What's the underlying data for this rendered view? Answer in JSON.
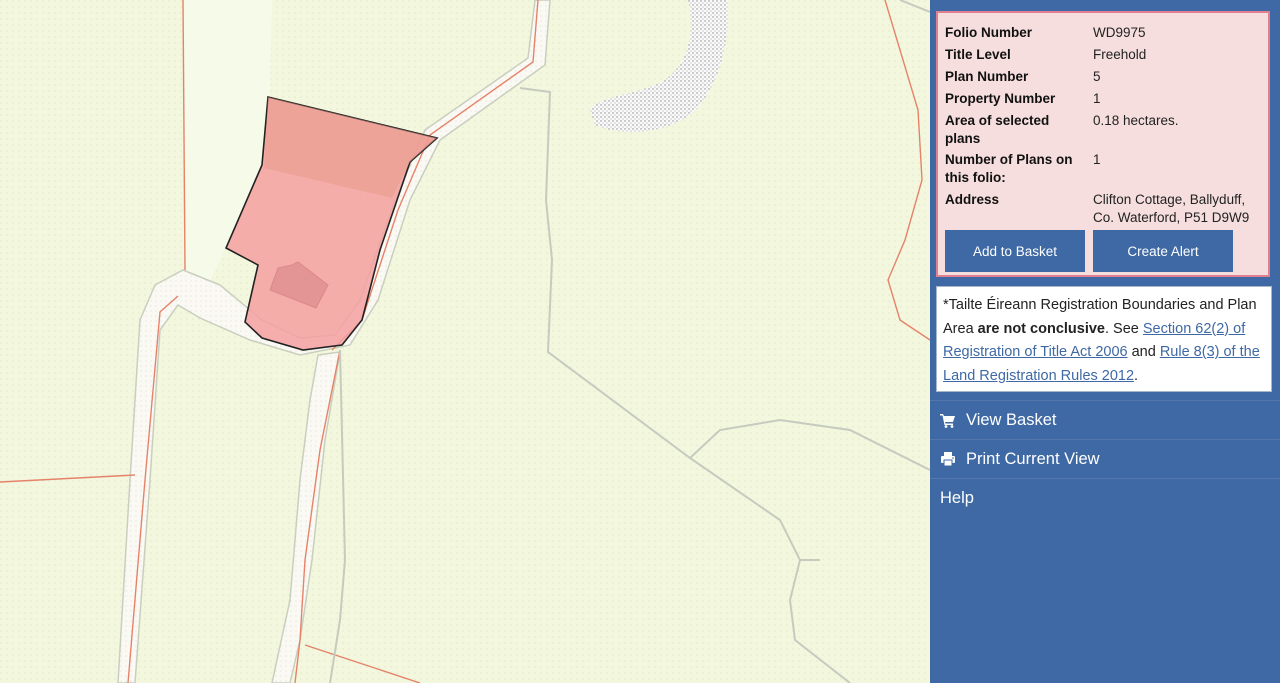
{
  "folio": {
    "rows": [
      {
        "label": "Folio Number",
        "value": "WD9975"
      },
      {
        "label": "Title Level",
        "value": "Freehold"
      },
      {
        "label": "Plan Number",
        "value": "5"
      },
      {
        "label": "Property Number",
        "value": "1"
      },
      {
        "label": "Area of selected plans",
        "value": "0.18 hectares."
      },
      {
        "label": "Number of Plans on this folio:",
        "value": "1"
      },
      {
        "label": "Address",
        "value": "Clifton Cottage, Ballyduff, Co. Waterford, P51 D9W9"
      }
    ],
    "add_to_basket_label": "Add to Basket",
    "create_alert_label": "Create Alert"
  },
  "disclaimer": {
    "prefix": "*Tailte Éireann Registration Boundaries and Plan Area ",
    "bold": "are not conclusive",
    "mid": ". See ",
    "link1": "Section 62(2) of Registration of Title Act 2006",
    "and": " and ",
    "link2": "Rule 8(3) of the Land Registration Rules 2012",
    "suffix": "."
  },
  "menu": {
    "view_basket": "View Basket",
    "print_view": "Print Current View",
    "help": "Help"
  },
  "colors": {
    "panel_bg": "#3e69a5",
    "parcel_fill": "#f4a0a0",
    "info_bg": "#f6dede"
  },
  "icons": {
    "basket": "shopping-cart-icon",
    "print": "printer-icon"
  }
}
